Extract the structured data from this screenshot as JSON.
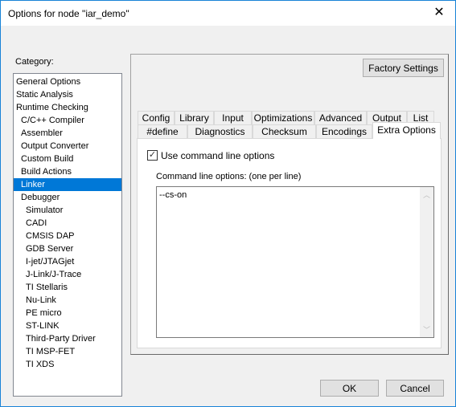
{
  "window": {
    "title": "Options for node \"iar_demo\"",
    "close_icon": "close-icon"
  },
  "category": {
    "label": "Category:",
    "selected": "Linker",
    "items": [
      {
        "label": "General Options",
        "level": 0
      },
      {
        "label": "Static Analysis",
        "level": 0
      },
      {
        "label": "Runtime Checking",
        "level": 0
      },
      {
        "label": "C/C++ Compiler",
        "level": 1
      },
      {
        "label": "Assembler",
        "level": 1
      },
      {
        "label": "Output Converter",
        "level": 1
      },
      {
        "label": "Custom Build",
        "level": 1
      },
      {
        "label": "Build Actions",
        "level": 1
      },
      {
        "label": "Linker",
        "level": 1
      },
      {
        "label": "Debugger",
        "level": 1
      },
      {
        "label": "Simulator",
        "level": 2
      },
      {
        "label": "CADI",
        "level": 2
      },
      {
        "label": "CMSIS DAP",
        "level": 2
      },
      {
        "label": "GDB Server",
        "level": 2
      },
      {
        "label": "I-jet/JTAGjet",
        "level": 2
      },
      {
        "label": "J-Link/J-Trace",
        "level": 2
      },
      {
        "label": "TI Stellaris",
        "level": 2
      },
      {
        "label": "Nu-Link",
        "level": 2
      },
      {
        "label": "PE micro",
        "level": 2
      },
      {
        "label": "ST-LINK",
        "level": 2
      },
      {
        "label": "Third-Party Driver",
        "level": 2
      },
      {
        "label": "TI MSP-FET",
        "level": 2
      },
      {
        "label": "TI XDS",
        "level": 2
      }
    ]
  },
  "factory_settings": "Factory Settings",
  "tabs_row1": [
    "Config",
    "Library",
    "Input",
    "Optimizations",
    "Advanced",
    "Output",
    "List"
  ],
  "tabs_row2": [
    "#define",
    "Diagnostics",
    "Checksum",
    "Encodings",
    "Extra Options"
  ],
  "selected_tab": "Extra Options",
  "extra": {
    "use_cmd_label": "Use command line options",
    "use_cmd_checked": true,
    "cmd_label": "Command line options:  (one per line)",
    "cmd_value": "--cs-on"
  },
  "buttons": {
    "ok": "OK",
    "cancel": "Cancel"
  },
  "colors": {
    "selection": "#0078d7",
    "border": "#1883d7"
  }
}
